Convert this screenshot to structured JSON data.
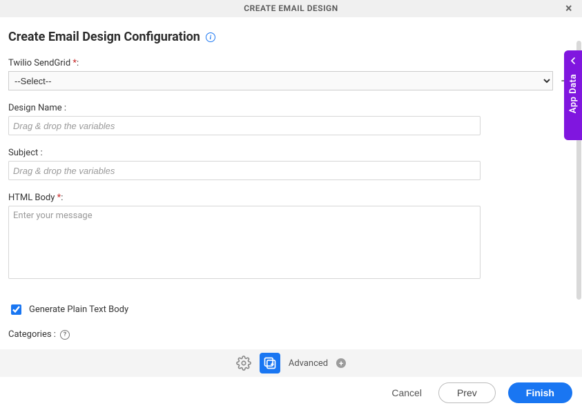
{
  "header": {
    "title": "CREATE EMAIL DESIGN"
  },
  "page": {
    "title": "Create Email Design Configuration"
  },
  "side_tab": {
    "label": "App Data"
  },
  "fields": {
    "sendgrid": {
      "label": "Twilio SendGrid",
      "required_marker": "*",
      "suffix": ":",
      "selected": "--Select--"
    },
    "design_name": {
      "label": "Design Name :",
      "placeholder": "Drag & drop the variables"
    },
    "subject": {
      "label": "Subject :",
      "placeholder": "Drag & drop the variables"
    },
    "html_body": {
      "label": "HTML Body",
      "required_marker": "*",
      "suffix": ":",
      "placeholder": "Enter your message"
    },
    "plain_text": {
      "label": "Generate Plain Text Body",
      "checked": true
    },
    "categories": {
      "label": "Categories :"
    }
  },
  "advanced": {
    "label": "Advanced"
  },
  "footer": {
    "cancel": "Cancel",
    "prev": "Prev",
    "finish": "Finish"
  }
}
